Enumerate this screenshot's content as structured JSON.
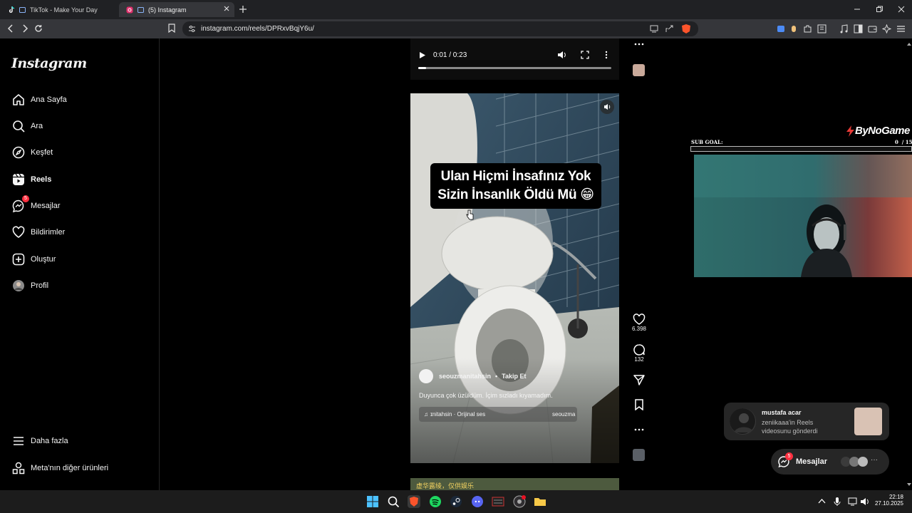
{
  "browser": {
    "tabs": [
      {
        "label": "TikTok - Make Your Day"
      },
      {
        "label": "(5) Instagram"
      }
    ],
    "url": "instagram.com/reels/DPRxvBqjY6u/"
  },
  "sidebar": {
    "logo": "Instagram",
    "items": [
      {
        "label": "Ana Sayfa",
        "icon": "home-icon"
      },
      {
        "label": "Ara",
        "icon": "search-icon"
      },
      {
        "label": "Keşfet",
        "icon": "compass-icon"
      },
      {
        "label": "Reels",
        "icon": "reels-icon"
      },
      {
        "label": "Mesajlar",
        "icon": "messenger-icon",
        "badge": "5"
      },
      {
        "label": "Bildirimler",
        "icon": "heart-icon"
      },
      {
        "label": "Oluştur",
        "icon": "plus-icon"
      },
      {
        "label": "Profil",
        "icon": "avatar"
      }
    ],
    "more": "Daha fazla",
    "meta": "Meta'nın diğer ürünleri"
  },
  "player": {
    "time": "0:01 / 0:23",
    "progress": 0.04
  },
  "reel": {
    "caption_line1": "Ulan Hiçmi İnsafınız Yok",
    "caption_line2": "Sizin İnsanlık Öldü Mü 😁",
    "username": "seouzmanitahsin",
    "follow": "Takip Et",
    "description": "Duyunca çok üzüldüm. İçim sızladı kıyamadım.",
    "audio": "ɪnitahsin · Orijinal ses",
    "audio_user": "seouzma",
    "likes": "6.398",
    "comments": "132",
    "next_caption": "虚华露绫，仅供娱乐"
  },
  "stream_overlay": {
    "brand": "ByNoGame",
    "sub_goal_label": "SUB GOAL:",
    "sub_goal_count": "0  / 15"
  },
  "notification": {
    "name": "mustafa acar",
    "text_line1": "zeniikaaa'in Reels",
    "text_line2": "videosunu gönderdi"
  },
  "messages_pill": {
    "label": "Mesajlar",
    "badge": "5",
    "more": "···"
  },
  "taskbar": {
    "time": "22:18",
    "date": "27.10.2025"
  },
  "colors": {
    "accent": "#ff3040",
    "bg": "#000000",
    "panel": "#262626"
  }
}
